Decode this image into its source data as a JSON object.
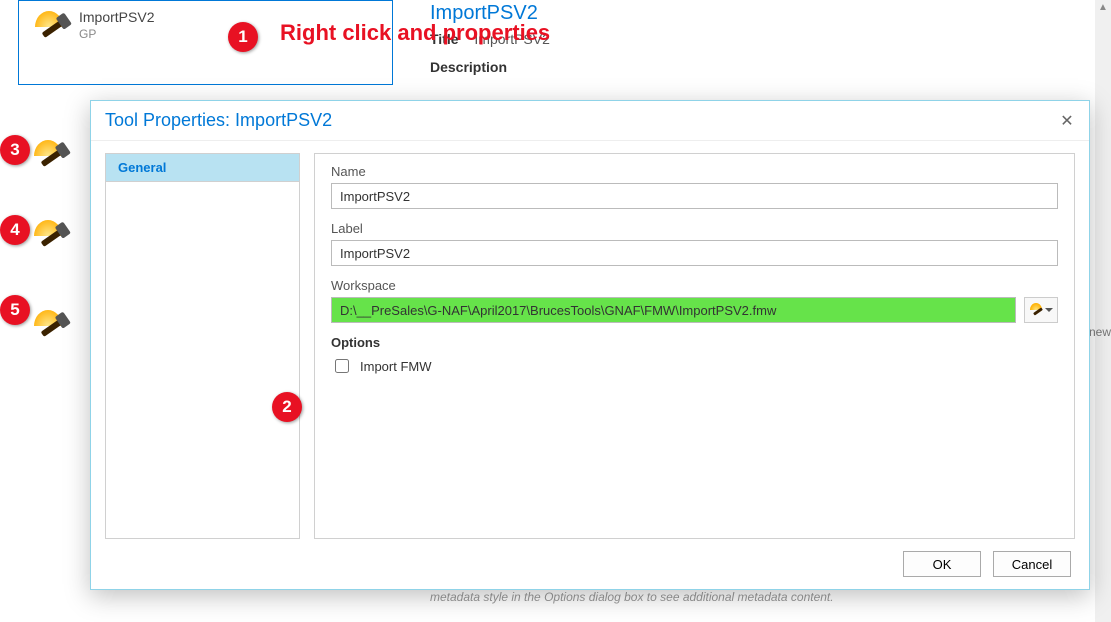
{
  "annotation": {
    "text": "Right click and properties"
  },
  "catalog": {
    "item_title": "ImportPSV2",
    "item_sub": "GP"
  },
  "info_panel": {
    "heading": "ImportPSV2",
    "title_label": "Title",
    "title_value": "ImportPSV2",
    "desc_label": "Description"
  },
  "footer_blur": "metadata style in the Options dialog box to see additional metadata content.",
  "cut_text": "new",
  "dialog": {
    "title": "Tool Properties: ImportPSV2",
    "nav": {
      "general": "General"
    },
    "fields": {
      "name_label": "Name",
      "name_value": "ImportPSV2",
      "label_label": "Label",
      "label_value": "ImportPSV2",
      "workspace_label": "Workspace",
      "workspace_value": "D:\\__PreSales\\G-NAF\\April2017\\BrucesTools\\GNAF\\FMW\\ImportPSV2.fmw",
      "options_heading": "Options",
      "import_fmw_label": "Import FMW"
    },
    "buttons": {
      "ok": "OK",
      "cancel": "Cancel"
    }
  },
  "badges": {
    "b1": "1",
    "b2": "2",
    "b3": "3",
    "b4": "4",
    "b5": "5"
  }
}
